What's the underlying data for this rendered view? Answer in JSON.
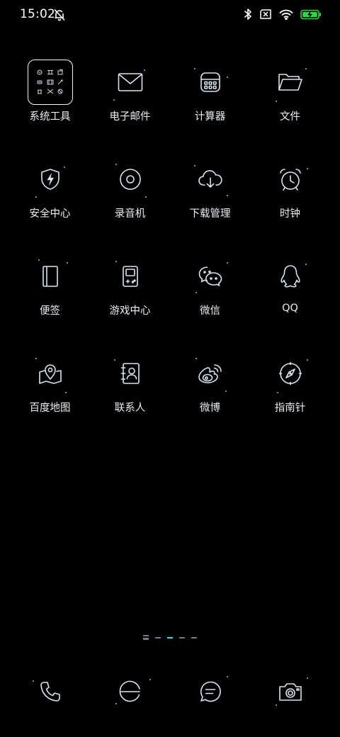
{
  "status_bar": {
    "time": "15:02",
    "icons": [
      "bell-off-icon",
      "bluetooth-icon",
      "no-sim-icon",
      "wifi-icon",
      "battery-charging-icon"
    ],
    "battery_color": "#33d24a"
  },
  "apps": {
    "row1": [
      {
        "label": "系统工具",
        "icon": "folder-tools-icon"
      },
      {
        "label": "电子邮件",
        "icon": "mail-icon"
      },
      {
        "label": "计算器",
        "icon": "calculator-icon"
      },
      {
        "label": "文件",
        "icon": "files-icon"
      }
    ],
    "row2": [
      {
        "label": "安全中心",
        "icon": "shield-icon"
      },
      {
        "label": "录音机",
        "icon": "recorder-icon"
      },
      {
        "label": "下载管理",
        "icon": "cloud-download-icon"
      },
      {
        "label": "时钟",
        "icon": "alarm-clock-icon"
      }
    ],
    "row3": [
      {
        "label": "便签",
        "icon": "notes-icon"
      },
      {
        "label": "游戏中心",
        "icon": "gameboy-icon"
      },
      {
        "label": "微信",
        "icon": "wechat-icon"
      },
      {
        "label": "QQ",
        "icon": "qq-icon"
      }
    ],
    "row4": [
      {
        "label": "百度地图",
        "icon": "map-pin-icon"
      },
      {
        "label": "联系人",
        "icon": "contacts-icon"
      },
      {
        "label": "微博",
        "icon": "weibo-icon"
      },
      {
        "label": "指南针",
        "icon": "compass-icon"
      }
    ]
  },
  "pager": {
    "pages": 4,
    "active_index": 1,
    "accent": "#3fd4f4"
  },
  "dock": [
    {
      "icon": "phone-icon"
    },
    {
      "icon": "browser-icon"
    },
    {
      "icon": "messages-icon"
    },
    {
      "icon": "camera-icon"
    }
  ]
}
